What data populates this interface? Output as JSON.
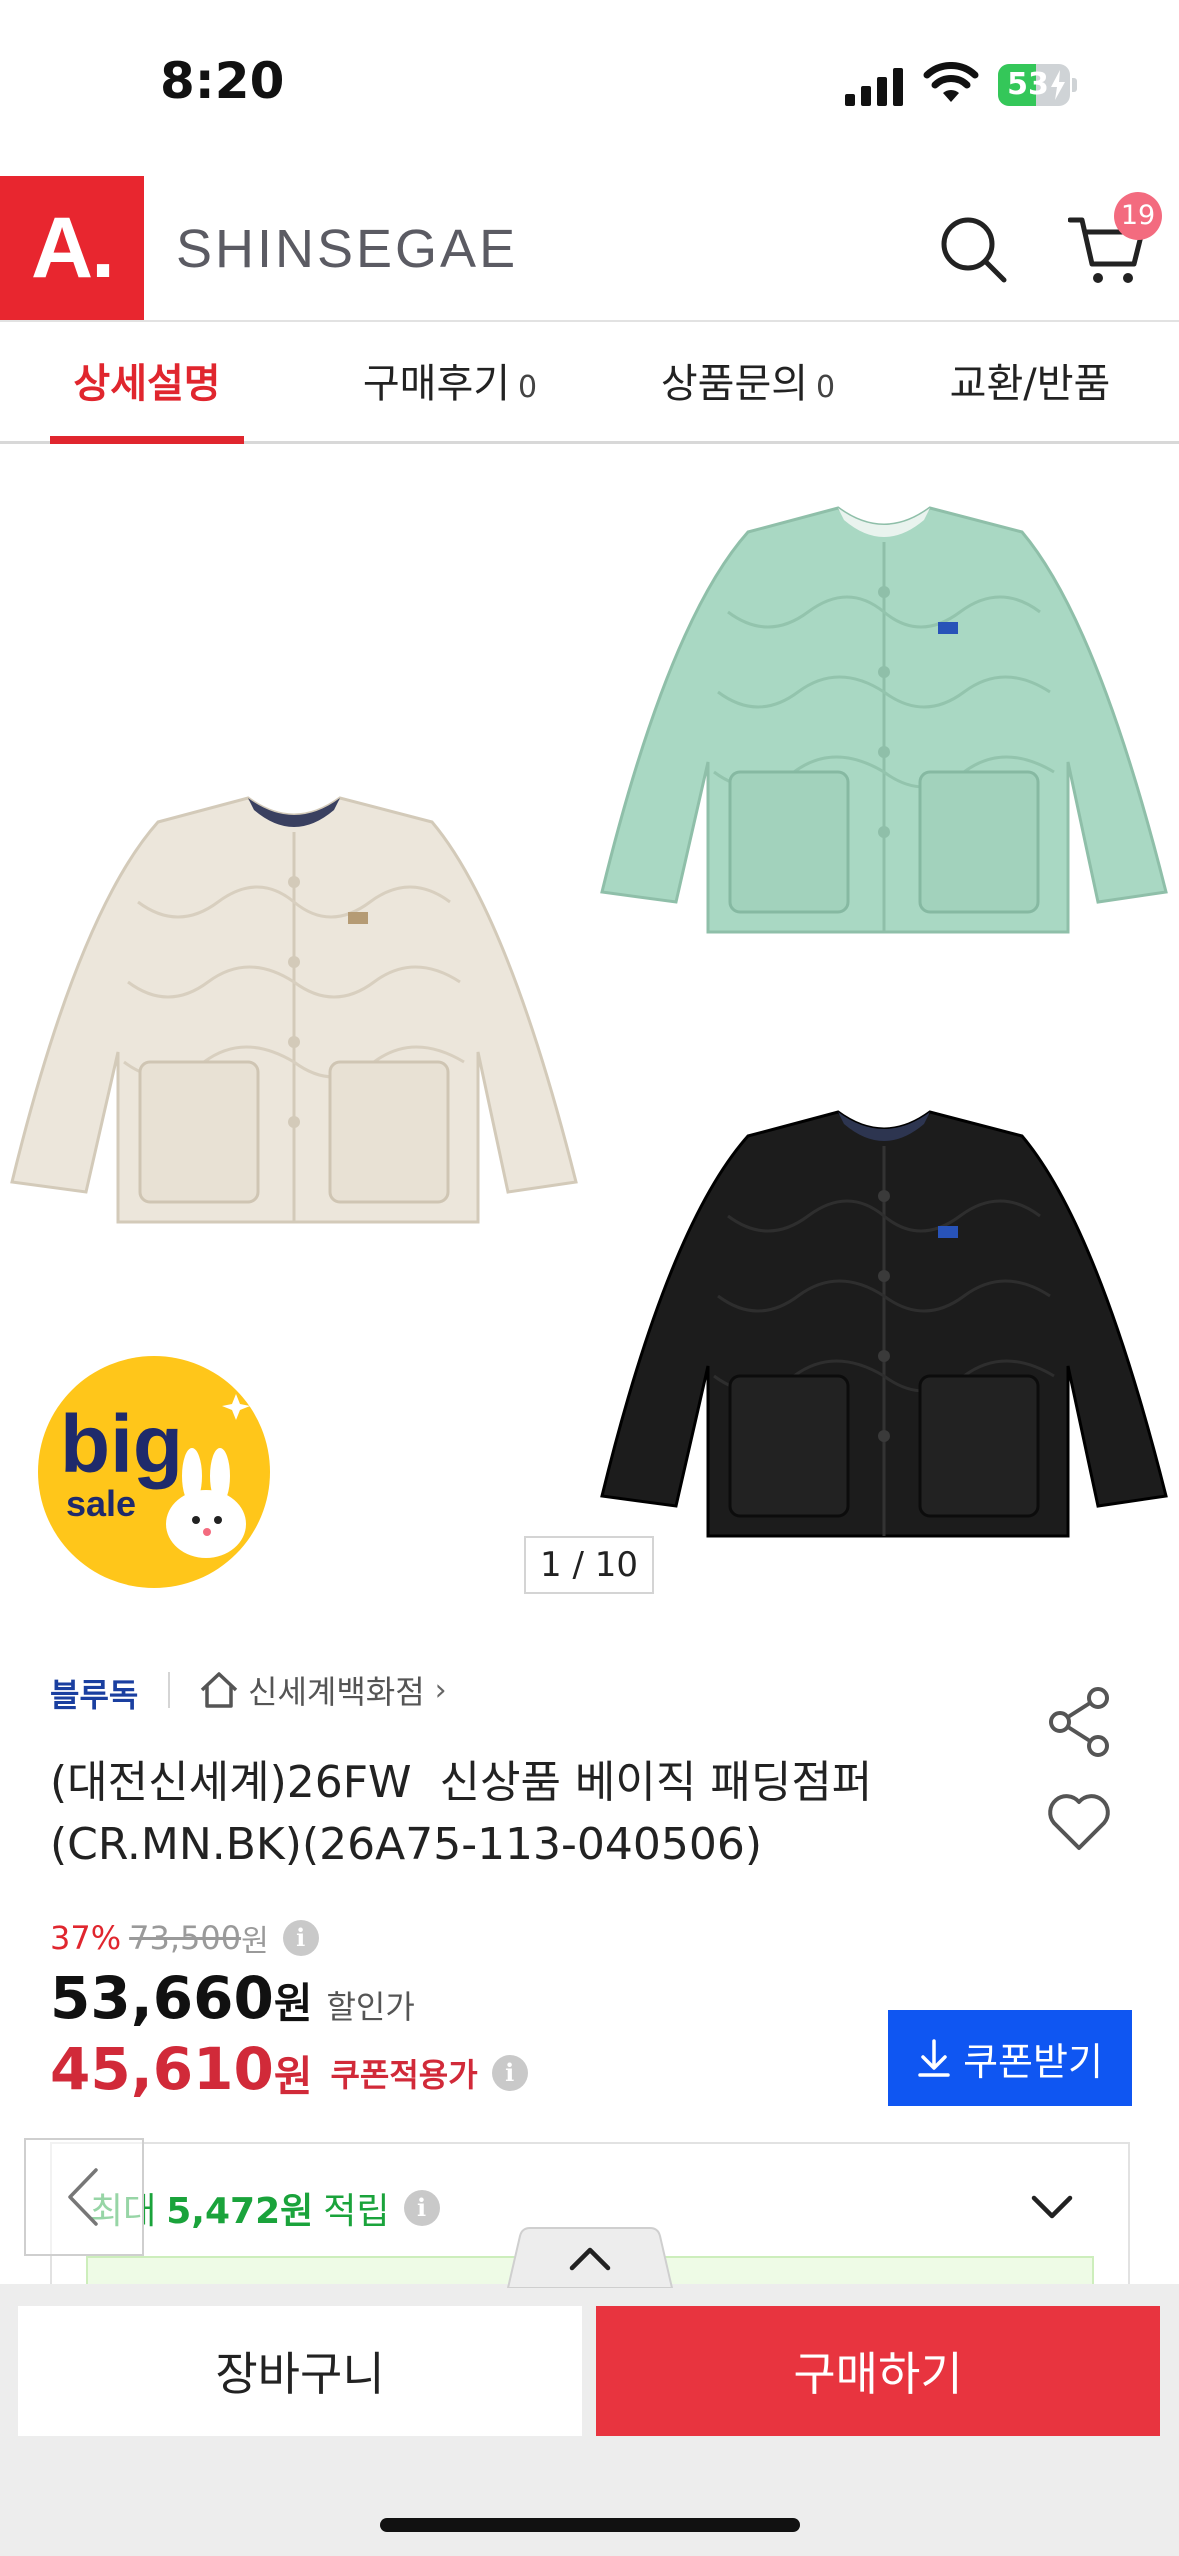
{
  "status_bar": {
    "time": "8:20",
    "battery": "53",
    "battery_level": 0.53,
    "icons": [
      "signal-icon",
      "wifi-icon",
      "battery-charging-icon"
    ]
  },
  "header": {
    "logo": "A.",
    "brand": "SHINSEGAE",
    "cart_count": "19",
    "icons": [
      "search-icon",
      "cart-icon"
    ],
    "colors": {
      "logo_bg": "#e8262f",
      "badge": "#f36b7f"
    }
  },
  "tabs": [
    {
      "label": "상세설명",
      "count": "",
      "active": true
    },
    {
      "label": "구매후기",
      "count": "0",
      "active": false
    },
    {
      "label": "상품문의",
      "count": "0",
      "active": false
    },
    {
      "label": "교환/반품",
      "count": "",
      "active": false
    }
  ],
  "gallery": {
    "pager": "1 / 10",
    "badge": {
      "big": "big",
      "sale": "sale"
    },
    "jacket_colors": [
      "#ece6db",
      "#a9d8c3",
      "#1c1c1c"
    ]
  },
  "product": {
    "seller": "블루독",
    "store": "신세계백화점",
    "title_line1": "(대전신세계)26FW  신상품 베이직 패딩점퍼",
    "title_line2": "(CR.MN.BK)(26A75-113-040506)",
    "discount_rate": "37%",
    "original_price": "73,500",
    "original_unit": "원",
    "sale_price": "53,660",
    "sale_unit": "원",
    "sale_label": "할인가",
    "coupon_price": "45,610",
    "coupon_unit": "원",
    "coupon_label": "쿠폰적용가",
    "coupon_button": "쿠폰받기",
    "reward_lead": "최대",
    "reward_amount": "5,472원",
    "reward_tail": "적립"
  },
  "bottom_bar": {
    "cart_button": "장바구니",
    "buy_button": "구매하기",
    "colors": {
      "buy": "#e8343f",
      "coupon": "#0f56f2"
    }
  }
}
